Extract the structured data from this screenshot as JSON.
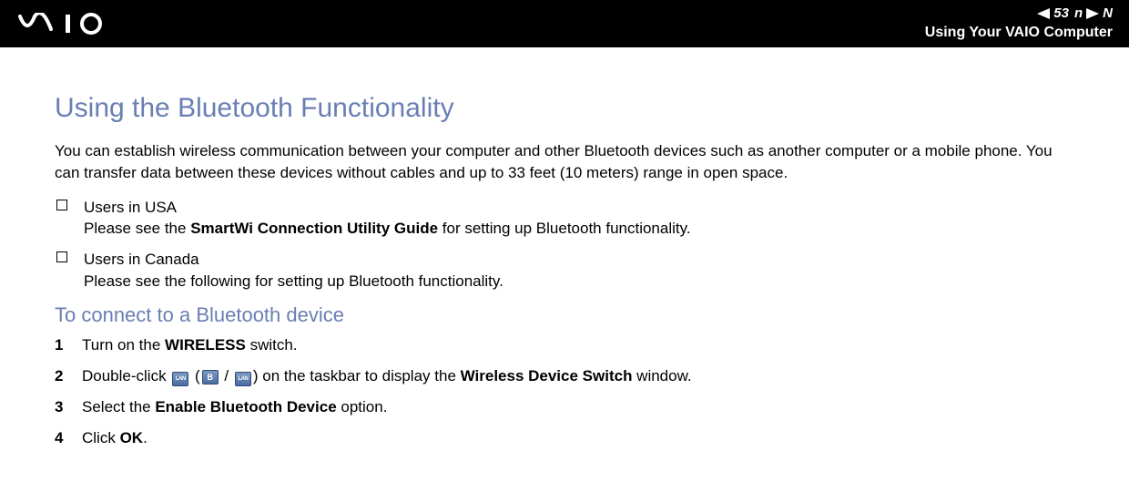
{
  "header": {
    "page_number": "53",
    "n_label": "n",
    "n_right_label": "N",
    "breadcrumb": "Using Your VAIO Computer"
  },
  "title": "Using the Bluetooth Functionality",
  "intro": "You can establish wireless communication between your computer and other Bluetooth devices such as another computer or a mobile phone. You can transfer data between these devices without cables and up to 33 feet (10 meters) range in open space.",
  "bullets": {
    "usa_title": "Users in USA",
    "usa_body_pre": "Please see the ",
    "usa_body_bold": "SmartWi Connection Utility Guide",
    "usa_body_post": " for setting up Bluetooth functionality.",
    "canada_title": "Users in Canada",
    "canada_body": "Please see the following for setting up Bluetooth functionality."
  },
  "sub_heading": "To connect to a Bluetooth device",
  "steps": {
    "s1_num": "1",
    "s1_pre": "Turn on the ",
    "s1_bold": "WIRELESS",
    "s1_post": " switch.",
    "s2_num": "2",
    "s2_pre": "Double-click ",
    "s2_paren_open": " (",
    "s2_slash": " / ",
    "s2_paren_close": ") ",
    "s2_mid": "on the taskbar to display the ",
    "s2_bold": "Wireless Device Switch",
    "s2_post": " window.",
    "s3_num": "3",
    "s3_pre": "Select the ",
    "s3_bold": "Enable Bluetooth Device",
    "s3_post": " option.",
    "s4_num": "4",
    "s4_pre": "Click ",
    "s4_bold": "OK",
    "s4_post": "."
  },
  "icons": {
    "b_label": "B",
    "lan_label": "LAN"
  }
}
